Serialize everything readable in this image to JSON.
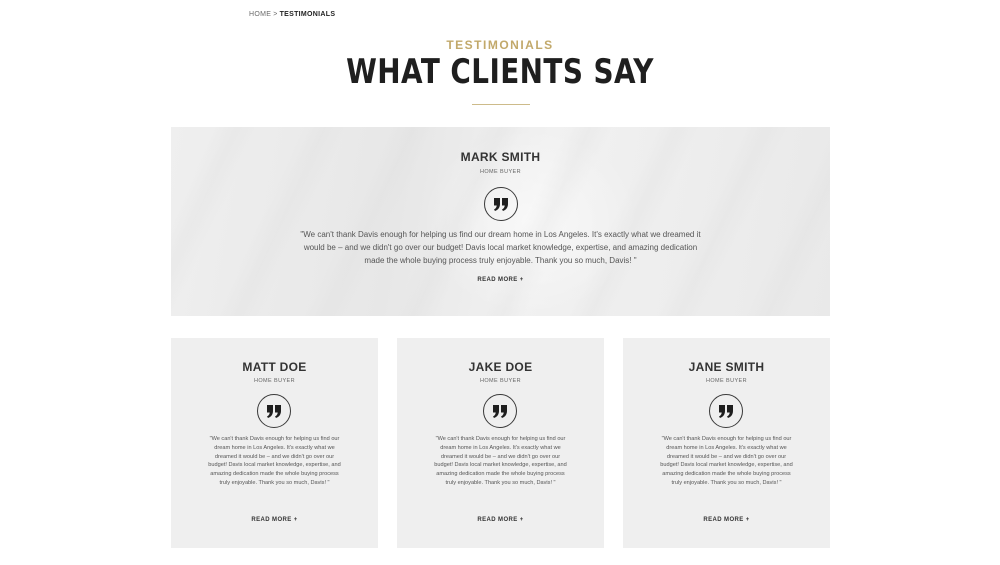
{
  "breadcrumb": {
    "home": "HOME",
    "separator": ">",
    "current": "TESTIMONIALS"
  },
  "header": {
    "eyebrow": "TESTIMONIALS",
    "title": "WHAT CLIENTS SAY"
  },
  "featured": {
    "name": "MARK SMITH",
    "role": "HOME BUYER",
    "quote": "\"We can't thank Davis enough for helping us find our dream home in Los Angeles. It's exactly what we dreamed it would be – and we didn't go over our budget! Davis local market knowledge, expertise, and amazing dedication made the whole buying process truly enjoyable. Thank you so much, Davis! \"",
    "read_more": "READ MORE +"
  },
  "cards": [
    {
      "name": "MATT DOE",
      "role": "HOME BUYER",
      "quote": "\"We can't thank Davis enough for helping us find our dream home in Los Angeles. It's exactly what we dreamed it would be – and we didn't go over our budget! Davis local market knowledge, expertise, and amazing dedication made the whole buying process truly enjoyable. Thank you so much, Davis! \"",
      "read_more": "READ MORE +"
    },
    {
      "name": "JAKE DOE",
      "role": "HOME BUYER",
      "quote": "\"We can't thank Davis enough for helping us find our dream home in Los Angeles. It's exactly what we dreamed it would be – and we didn't go over our budget! Davis local market knowledge, expertise, and amazing dedication made the whole buying process truly enjoyable. Thank you so much, Davis! \"",
      "read_more": "READ MORE +"
    },
    {
      "name": "JANE SMITH",
      "role": "HOME BUYER",
      "quote": "\"We can't thank Davis enough for helping us find our dream home in Los Angeles. It's exactly what we dreamed it would be – and we didn't go over our budget! Davis local market knowledge, expertise, and amazing dedication made the whole buying process truly enjoyable. Thank you so much, Davis! \"",
      "read_more": "READ MORE +"
    }
  ],
  "icons": {
    "quote": "quote-icon"
  },
  "colors": {
    "accent": "#c2a96b",
    "card_bg": "#efefef",
    "heading": "#1f1f1f"
  }
}
